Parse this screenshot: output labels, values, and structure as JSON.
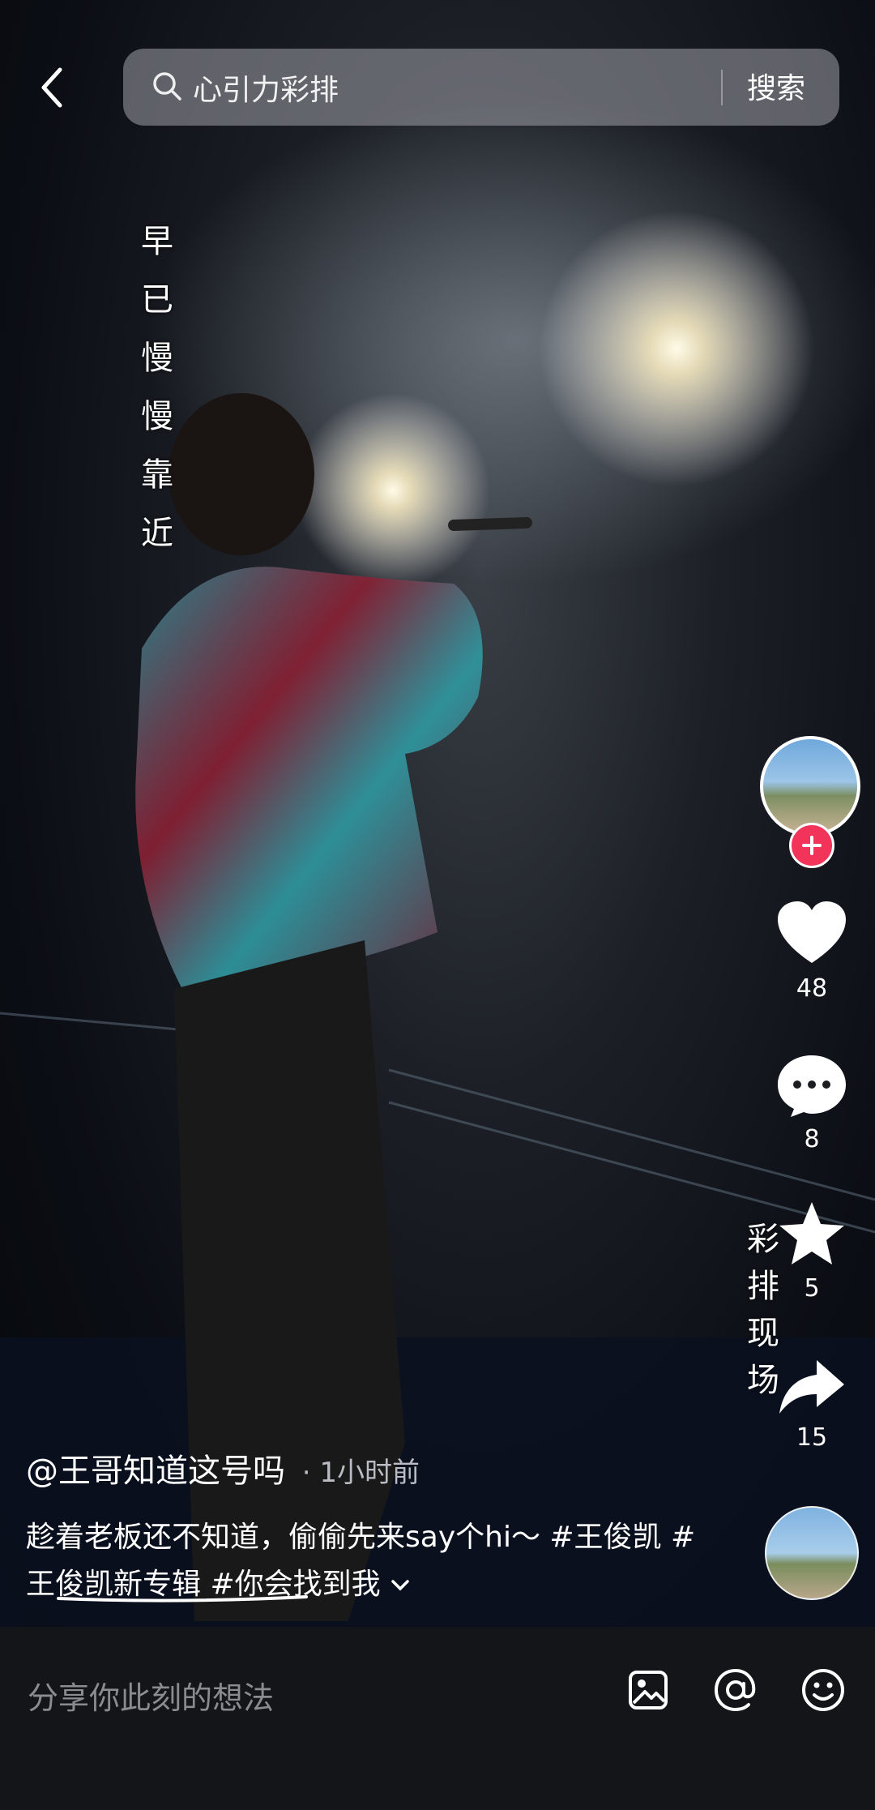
{
  "search": {
    "query": "心引力彩排",
    "button_label": "搜索"
  },
  "video": {
    "lyric_overlay": "早已慢慢靠近",
    "tag_overlay": "彩排现场",
    "author": "@王哥知道这号吗",
    "time_separator": "·",
    "posted": "1小时前",
    "caption_text": "趁着老板还不知道，偷偷先来say个hi～ ",
    "hashtags": [
      "#王俊凯",
      "#王俊凯新专辑",
      "#你会找到我"
    ]
  },
  "actions": {
    "follow_icon": "plus-icon",
    "likes": "48",
    "comments": "8",
    "favorites": "5",
    "shares": "15"
  },
  "comment_bar": {
    "placeholder": "分享你此刻的想法"
  },
  "colors": {
    "follow": "#f2335a",
    "comment_bar_bg": "#141518"
  }
}
